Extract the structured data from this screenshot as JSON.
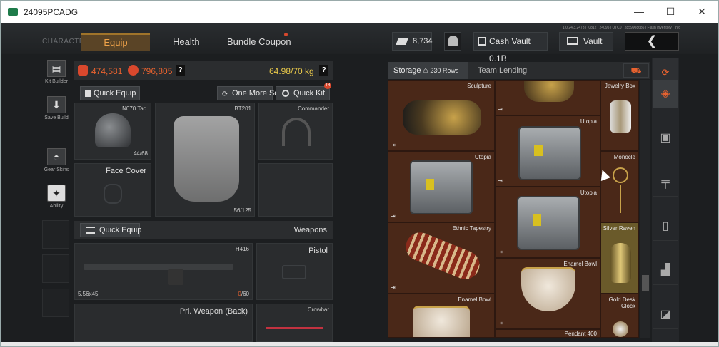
{
  "window": {
    "title": "24095PCADG",
    "minimize": "—",
    "maximize": "☐",
    "close": "✕"
  },
  "top_nav": {
    "character_label": "CHARACTER",
    "tabs": [
      "Equip",
      "Health",
      "Bundle Coupon"
    ],
    "currency": "8,734",
    "cash_vault": "Cash Vault 0.1B",
    "vault": "Vault",
    "back_glyph": "❮",
    "build_info": "1.0.24.3.2478 | (0812 | 24095 | UTC0 | 2859908686 | Flash Inventory | Info"
  },
  "sidebar": {
    "items": [
      {
        "label": "Kit Builder",
        "icon": "kit-builder-icon",
        "glyph": "▤"
      },
      {
        "label": "Save Build",
        "icon": "save-build-icon",
        "glyph": "⬇"
      },
      {
        "label": "Gear Skins",
        "icon": "gear-skins-icon",
        "glyph": "◓"
      },
      {
        "label": "Ability",
        "icon": "ability-icon",
        "glyph": "✦"
      }
    ]
  },
  "stats": {
    "value_left": "474,581",
    "value_right": "796,805",
    "weight": "64.98/70 kg",
    "help": "?"
  },
  "equip_buttons": {
    "quick_equip": "Quick Equip",
    "one_more_set": "One More Set",
    "quick_kit": "Quick Kit",
    "quick_kit_badge": "18"
  },
  "gear": {
    "helmet": {
      "name": "N070 Tac.",
      "durability": "44/68"
    },
    "armor": {
      "name": "BT201",
      "durability": "56/125"
    },
    "headset": {
      "name": "Commander"
    },
    "face_cover": {
      "name": "Face Cover"
    }
  },
  "weapons": {
    "quick_equip": "Quick Equip",
    "section_label": "Weapons",
    "primary": {
      "name": "H416",
      "caliber": "5.56x45",
      "ammo_current": "0",
      "ammo_sep": "/",
      "ammo_max": "60"
    },
    "pistol": {
      "name": "Pistol"
    },
    "pri_back": {
      "name": "Pri. Weapon (Back)"
    },
    "melee": {
      "name": "Crowbar"
    }
  },
  "storage": {
    "label": "Storage",
    "rows": "230 Rows",
    "team_lending": "Team Lending",
    "marker": "⇥",
    "items": [
      {
        "name": "Sculpture"
      },
      {
        "name": "Utopia"
      },
      {
        "name": "Jewelry Box"
      },
      {
        "name": "Utopia"
      },
      {
        "name": "Monocle"
      },
      {
        "name": "Utopia"
      },
      {
        "name": "Ethnic Tapestry"
      },
      {
        "name": "Silver Raven"
      },
      {
        "name": "Enamel Bowl"
      },
      {
        "name": "Enamel Bowl"
      },
      {
        "name": "Gold Desk Clock"
      },
      {
        "name": "Pendant 400"
      }
    ]
  },
  "colors": {
    "accent": "#f0a34a",
    "danger": "#d9482d",
    "weight": "#e8c84a"
  }
}
